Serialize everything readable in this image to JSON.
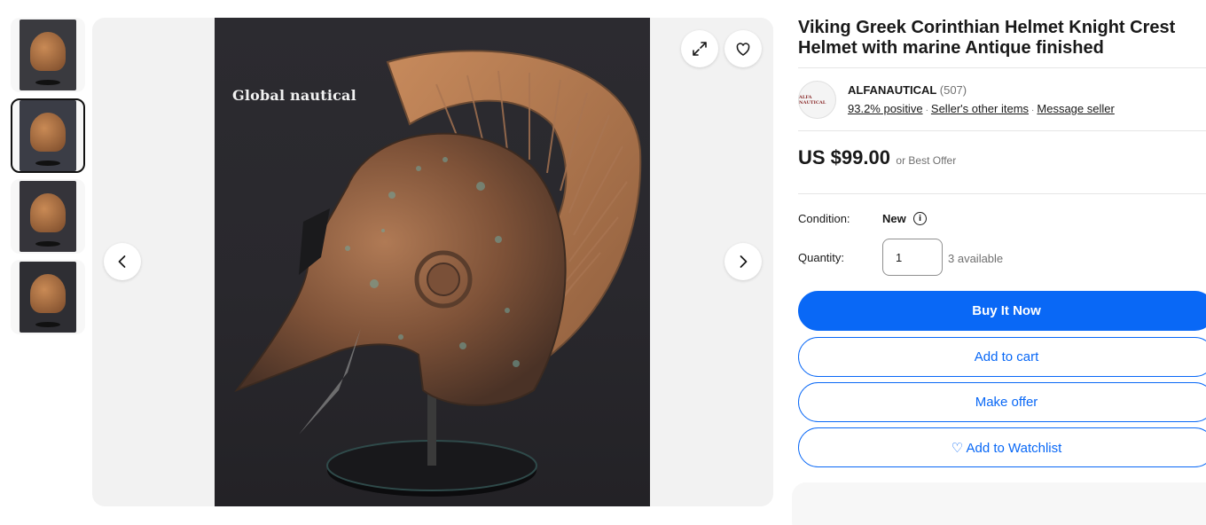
{
  "thumbnails": [
    {
      "label": "helmet-front-view"
    },
    {
      "label": "helmet-side-view",
      "selected": true
    },
    {
      "label": "helmet-back-view"
    },
    {
      "label": "helmet-angle-view"
    }
  ],
  "gallery": {
    "watermark": "Global nautical",
    "expand_icon": "expand-icon",
    "watchlist_icon": "heart-icon",
    "prev_icon": "chevron-left-icon",
    "next_icon": "chevron-right-icon"
  },
  "listing": {
    "title": "Viking Greek Corinthian Helmet Knight Crest Helmet with marine Antique finished"
  },
  "seller": {
    "logo_text": "ALFA NAUTICAL",
    "name": "ALFANAUTICAL",
    "feedback_count": "(507)",
    "positive": "93.2% positive",
    "other_items": "Seller's other items",
    "message": "Message seller"
  },
  "price": {
    "amount": "US $99.00",
    "suffix": "or Best Offer"
  },
  "condition": {
    "label": "Condition:",
    "value": "New",
    "info_icon": "info-icon"
  },
  "quantity": {
    "label": "Quantity:",
    "value": "1",
    "available": "3 available"
  },
  "actions": {
    "buy_now": "Buy It Now",
    "add_to_cart": "Add to cart",
    "make_offer": "Make offer",
    "watchlist": "♡ Add to Watchlist"
  },
  "colors": {
    "accent": "#0968f6",
    "text": "#191919",
    "muted": "#707070"
  }
}
